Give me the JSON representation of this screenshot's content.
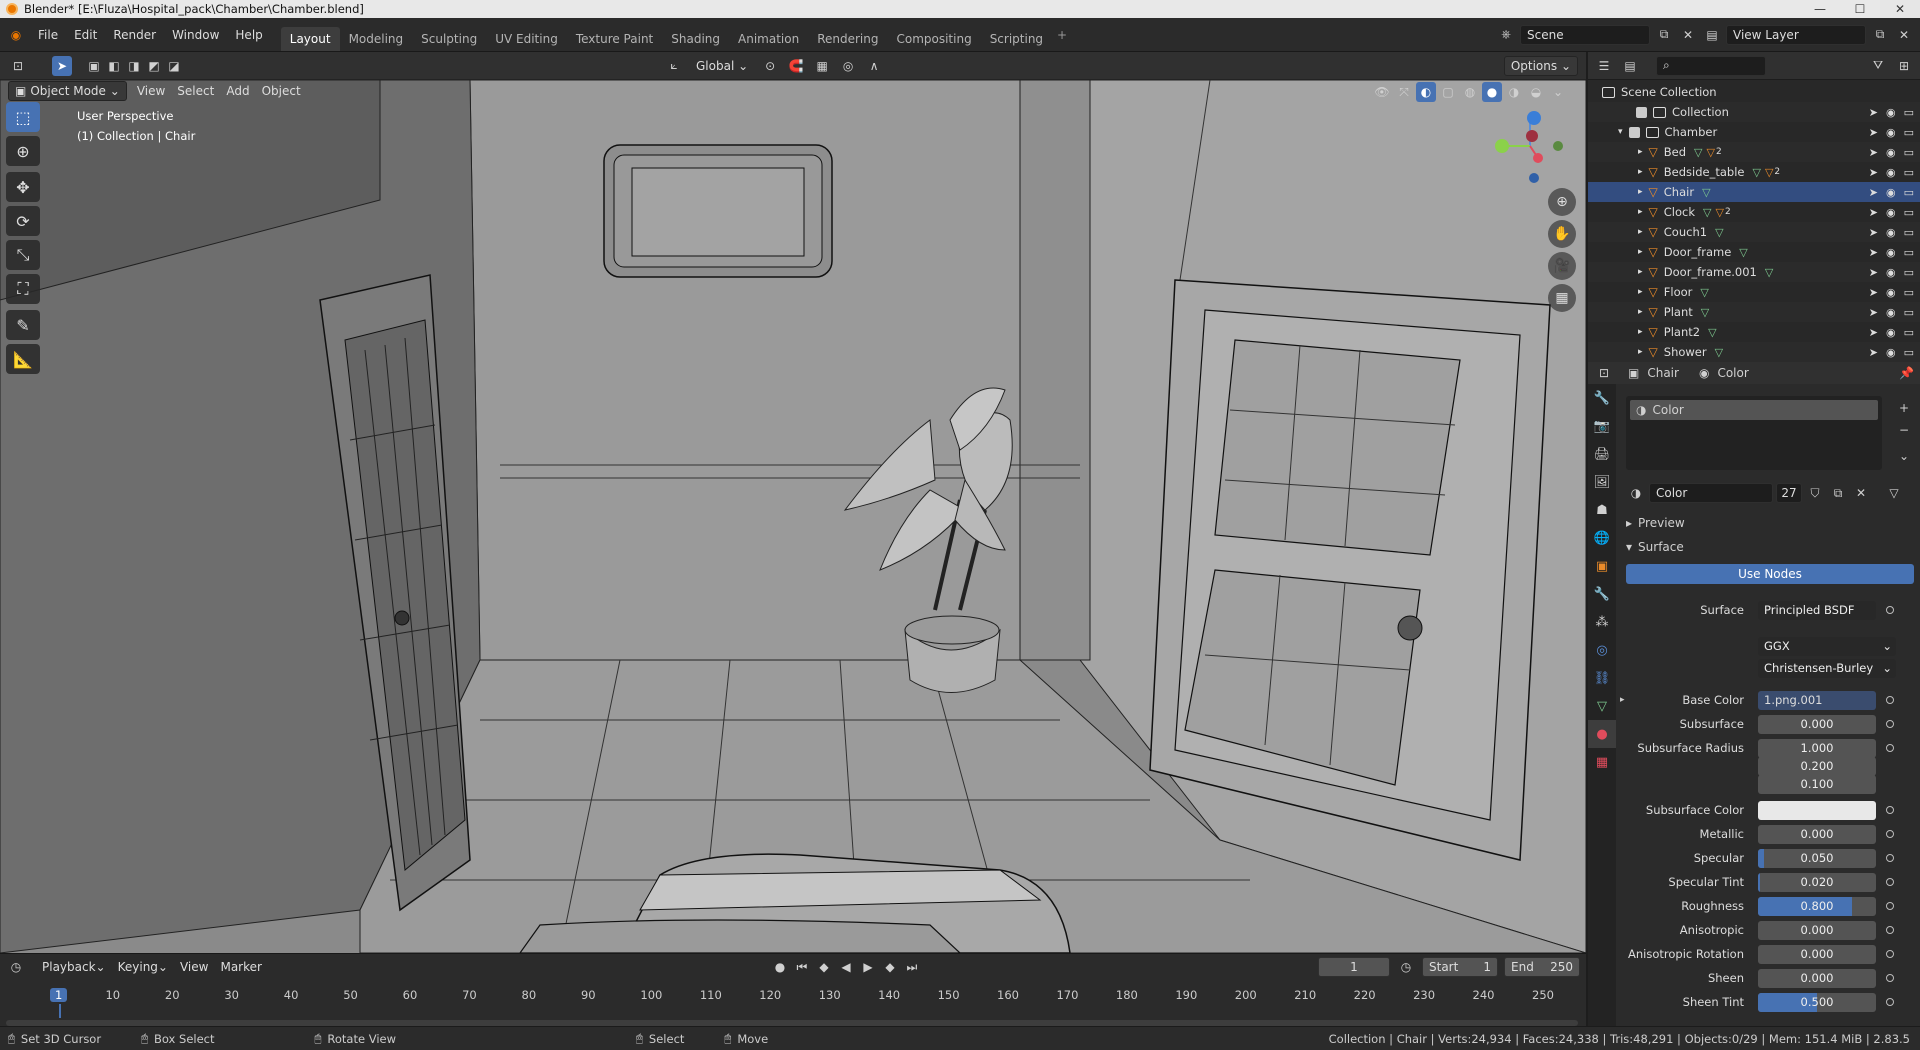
{
  "window": {
    "title": "Blender* [E:\\Fluza\\Hospital_pack\\Chamber\\Chamber.blend]"
  },
  "menu": [
    "File",
    "Edit",
    "Render",
    "Window",
    "Help"
  ],
  "workspaces": [
    "Layout",
    "Modeling",
    "Sculpting",
    "UV Editing",
    "Texture Paint",
    "Shading",
    "Animation",
    "Rendering",
    "Compositing",
    "Scripting"
  ],
  "scene": {
    "name": "Scene",
    "view_layer": "View Layer"
  },
  "toolheader": {
    "orientation": "Global",
    "options": "Options"
  },
  "viewport_header": {
    "mode": "Object Mode",
    "menus": [
      "View",
      "Select",
      "Add",
      "Object"
    ]
  },
  "viewport": {
    "perspective": "User Perspective",
    "collection": "(1) Collection | Chair"
  },
  "outliner": {
    "root": "Scene Collection",
    "collections": [
      "Collection",
      "Chamber"
    ],
    "objects": [
      {
        "name": "Bed",
        "badge": "2"
      },
      {
        "name": "Bedside_table",
        "badge": "2"
      },
      {
        "name": "Chair",
        "badge": ""
      },
      {
        "name": "Clock",
        "badge": "2"
      },
      {
        "name": "Couch1",
        "badge": ""
      },
      {
        "name": "Door_frame",
        "badge": ""
      },
      {
        "name": "Door_frame.001",
        "badge": ""
      },
      {
        "name": "Floor",
        "badge": ""
      },
      {
        "name": "Plant",
        "badge": ""
      },
      {
        "name": "Plant2",
        "badge": ""
      },
      {
        "name": "Shower",
        "badge": ""
      }
    ]
  },
  "properties": {
    "breadcrumb_object": "Chair",
    "breadcrumb_material": "Color",
    "slot": "Color",
    "material_name": "Color",
    "material_users": "27",
    "panel_preview": "Preview",
    "panel_surface": "Surface",
    "use_nodes": "Use Nodes",
    "surface_label": "Surface",
    "surface_value": "Principled BSDF",
    "distribution": "GGX",
    "subsurface_method": "Christensen-Burley",
    "rows": [
      {
        "label": "Base Color",
        "value": "1.png.001",
        "kind": "link"
      },
      {
        "label": "Subsurface",
        "value": "0.000",
        "fill": 0
      },
      {
        "label": "Subsurface Radius",
        "value": "1.000",
        "fill": 0
      },
      {
        "label": "",
        "value": "0.200",
        "fill": 0
      },
      {
        "label": "",
        "value": "0.100",
        "fill": 0
      },
      {
        "label": "Subsurface Color",
        "value": "",
        "kind": "color"
      },
      {
        "label": "Metallic",
        "value": "0.000",
        "fill": 0
      },
      {
        "label": "Specular",
        "value": "0.050",
        "fill": 0.05
      },
      {
        "label": "Specular Tint",
        "value": "0.020",
        "fill": 0.02
      },
      {
        "label": "Roughness",
        "value": "0.800",
        "fill": 0.8
      },
      {
        "label": "Anisotropic",
        "value": "0.000",
        "fill": 0
      },
      {
        "label": "Anisotropic Rotation",
        "value": "0.000",
        "fill": 0
      },
      {
        "label": "Sheen",
        "value": "0.000",
        "fill": 0
      },
      {
        "label": "Sheen Tint",
        "value": "0.500",
        "fill": 0.5
      }
    ]
  },
  "timeline": {
    "menus": [
      "Playback",
      "Keying",
      "View",
      "Marker"
    ],
    "current_frame": "1",
    "start_label": "Start",
    "start": "1",
    "end_label": "End",
    "end": "250",
    "ticks": [
      "1",
      "10",
      "20",
      "30",
      "40",
      "50",
      "60",
      "70",
      "80",
      "90",
      "100",
      "110",
      "120",
      "130",
      "140",
      "150",
      "160",
      "170",
      "180",
      "190",
      "200",
      "210",
      "220",
      "230",
      "240",
      "250"
    ]
  },
  "status": {
    "left": [
      "Set 3D Cursor",
      "Box Select",
      "Rotate View",
      "Select",
      "Move"
    ],
    "right": "Collection | Chair | Verts:24,934 | Faces:24,338 | Tris:48,291 | Objects:0/29 | Mem: 151.4 MiB | 2.83.5"
  },
  "colors": {
    "accent": "#4772b3",
    "object": "#ea8b2a",
    "mesh": "#7ec98f",
    "background": "#2b2b2b"
  }
}
